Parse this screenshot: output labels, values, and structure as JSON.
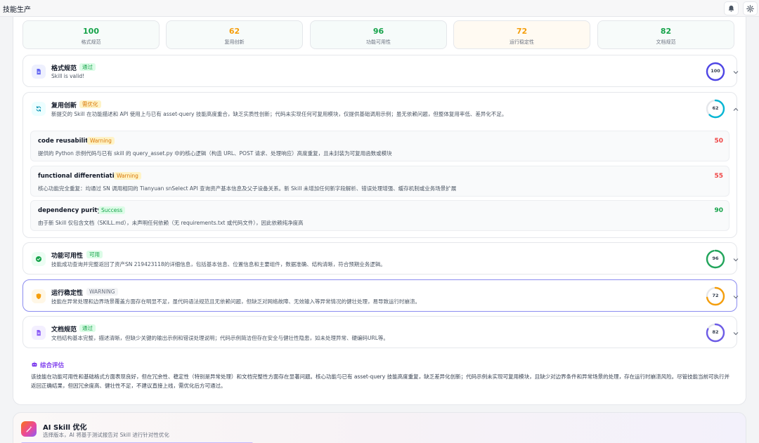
{
  "app": {
    "title": "技能生产"
  },
  "metrics": [
    {
      "value": "100",
      "label": "格式规范",
      "color": "#16a34a",
      "bg": "#f7fbfa"
    },
    {
      "value": "62",
      "label": "复用创新",
      "color": "#f59e0b",
      "bg": "#f7fbfa"
    },
    {
      "value": "96",
      "label": "功能可用性",
      "color": "#16a34a",
      "bg": "#f6fbfa"
    },
    {
      "value": "72",
      "label": "运行稳定性",
      "color": "#f59e0b",
      "bg": "#fffaf2"
    },
    {
      "value": "82",
      "label": "文档规范",
      "color": "#16a34a",
      "bg": "#f7fbfa"
    }
  ],
  "cards": {
    "format": {
      "title": "格式规范",
      "badge": "通过",
      "desc": "Skill is valid!",
      "score": "100",
      "progress": 1.0,
      "ring_color": "#4f46e5"
    },
    "reuse": {
      "title": "复用创新",
      "badge": "需优化",
      "desc": "新提交的 Skill 在功能描述和 API 使用上与已有 asset-query 技能高度重合，缺乏实质性创新；代码未实现任何可复用模块，仅提供基础调用示例；虽无依赖问题，但整体复用率低、差异化不足。",
      "score": "62",
      "progress": 0.62,
      "ring_color": "#06b6d4",
      "items": [
        {
          "name": "code reusability",
          "badge": "Warning",
          "desc": "提供的 Python 示例代码与已有 skill 的 query_asset.py 中的核心逻辑（构造 URL、POST 请求、处理响应）高度重复，且未封装为可复用函数或模块",
          "score": "50"
        },
        {
          "name": "functional differentiation",
          "badge": "Warning",
          "desc": "核心功能完全重复：均通过 SN 调用相同的 Tianyuan snSelect API 查询资产基本信息及父子设备关系。新 Skill 未增加任何新字段解析、错误处理增强、缓存机制或业务场景扩展",
          "score": "55"
        },
        {
          "name": "dependency purity",
          "badge": "Success",
          "desc": "由于新 Skill 仅包含文档（SKILL.md），未声明任何依赖（无 requirements.txt 或代码文件），因此依赖纯净度高",
          "score": "90"
        }
      ]
    },
    "function": {
      "title": "功能可用性",
      "badge": "可用",
      "desc": "技能成功查询并完整返回了资产SN 219423118的详细信息，包括基本信息、位置信息和主要组件，数据准确、结构清晰，符合预期业务逻辑。",
      "score": "96",
      "progress": 0.96,
      "ring_color": "#22a55b"
    },
    "stability": {
      "title": "运行稳定性",
      "badge": "WARNING",
      "desc": "技能在异常处理和边界场景覆盖方面存在明显不足，虽代码语法规范且无依赖问题，但缺乏对网络故障、无效输入等异常情况的健壮处理，易导致运行时崩溃。",
      "score": "72",
      "progress": 0.72,
      "ring_color": "#f59e0b"
    },
    "docs": {
      "title": "文档规范",
      "badge": "通过",
      "desc": "文档结构基本完整，描述清晰，但缺少关键的输出示例和错误处理说明；代码示例简洁但存在安全与健壮性隐患，如未处理异常、硬编码URL等。",
      "score": "82",
      "progress": 0.82,
      "ring_color": "#6d5ce6"
    }
  },
  "summary": {
    "title": "综合评估",
    "text": "该技能在功能可用性和基础格式方面表现良好，但在冗余性、稳定性（特别是异常处理）和文档完整性方面存在显著问题。核心功能与已有 asset-query 技能高度重复，缺乏差异化创新；代码示例未实现可复用模块，且缺少对边界条件和异常场景的处理，存在运行时崩溃风险。尽管技能当前可执行并返回正确结果，但因冗余度高、健壮性不足，不建议直接上线，需优化后方可通过。"
  },
  "ai_panel": {
    "title": "AI Skill 优化",
    "desc": "选择版本，AI 将基于测试报告对 Skill 进行针对性优化"
  },
  "icons": {
    "bell": "bell-icon",
    "gear": "gear-icon",
    "doc": "document-icon",
    "refresh": "refresh-icon",
    "check": "check-circle-icon",
    "shield": "shield-icon",
    "robot": "robot-icon",
    "wand": "magic-wand-icon"
  }
}
